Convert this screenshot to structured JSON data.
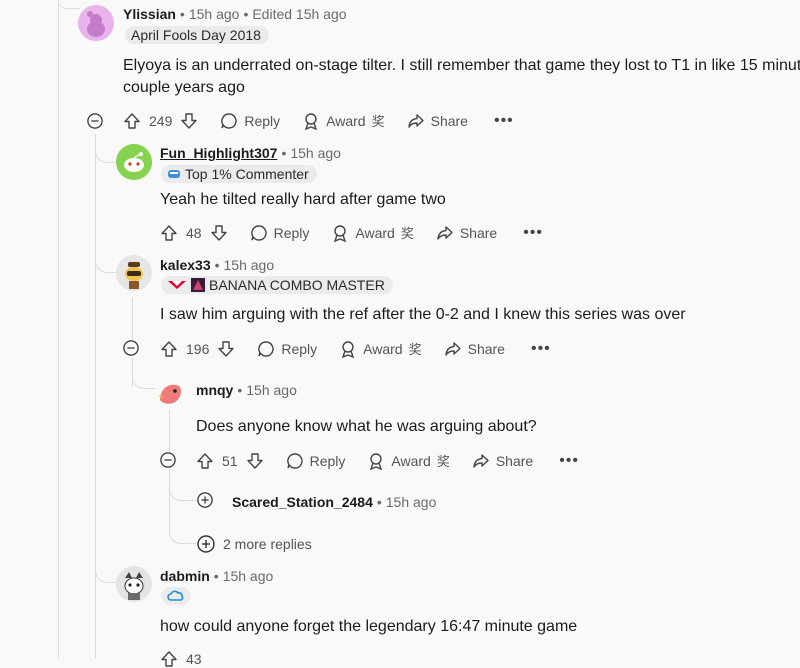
{
  "comments": [
    {
      "username": "Ylissian",
      "time": "15h ago",
      "edited": "Edited 15h ago",
      "flair": "April Fools Day 2018",
      "body_line1": "Elyoya is an underrated on-stage tilter. I still remember that game they lost to T1 in like 15 minut",
      "body_line2": "couple years ago",
      "votes": "249",
      "reply": "Reply",
      "award": "Award",
      "share": "Share"
    },
    {
      "username": "Fun_Highlight307",
      "time": "15h ago",
      "flair": "Top 1% Commenter",
      "body": "Yeah he tilted really hard after game two",
      "votes": "48",
      "reply": "Reply",
      "award": "Award",
      "share": "Share"
    },
    {
      "username": "kalex33",
      "time": "15h ago",
      "flair": "BANANA COMBO MASTER",
      "body": "I saw him arguing with the ref after the 0-2 and I knew this series was over",
      "votes": "196",
      "reply": "Reply",
      "award": "Award",
      "share": "Share"
    },
    {
      "username": "mnqy",
      "time": "15h ago",
      "body": "Does anyone know what he was arguing about?",
      "votes": "51",
      "reply": "Reply",
      "award": "Award",
      "share": "Share"
    },
    {
      "username": "Scared_Station_2484",
      "time": "15h ago"
    },
    {
      "more_replies": "2 more replies"
    },
    {
      "username": "dabmin",
      "time": "15h ago",
      "body": "how could anyone forget the legendary 16:47 minute game",
      "votes": "43"
    }
  ],
  "colors": {
    "accent": "#0079d3",
    "muted": "#6a6a6a",
    "thread": "#dcdcdc"
  }
}
